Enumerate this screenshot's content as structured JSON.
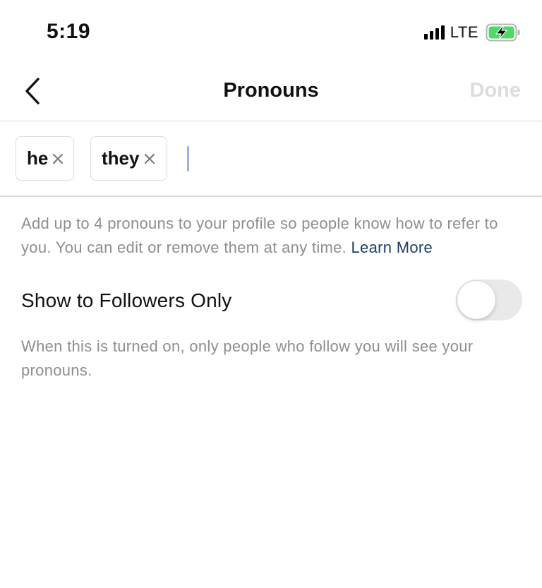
{
  "status_bar": {
    "time": "5:19",
    "network": "LTE",
    "signal_icon": "signal-bars-icon",
    "battery_icon": "battery-charging-icon",
    "battery_color": "#4cd964"
  },
  "nav": {
    "back_icon": "chevron-left-icon",
    "title": "Pronouns",
    "done_label": "Done"
  },
  "pronouns": {
    "chips": [
      {
        "label": "he",
        "remove_icon": "close-icon"
      },
      {
        "label": "they",
        "remove_icon": "close-icon"
      }
    ],
    "input_value": ""
  },
  "description": {
    "text": "Add up to 4 pronouns to your profile so people know how to refer to you. You can edit or remove them at any time.",
    "link_label": "Learn More",
    "link_color": "#1c3f67"
  },
  "followers_only": {
    "label": "Show to Followers Only",
    "enabled": false,
    "hint": "When this is turned on, only people who follow you will see your pronouns."
  }
}
